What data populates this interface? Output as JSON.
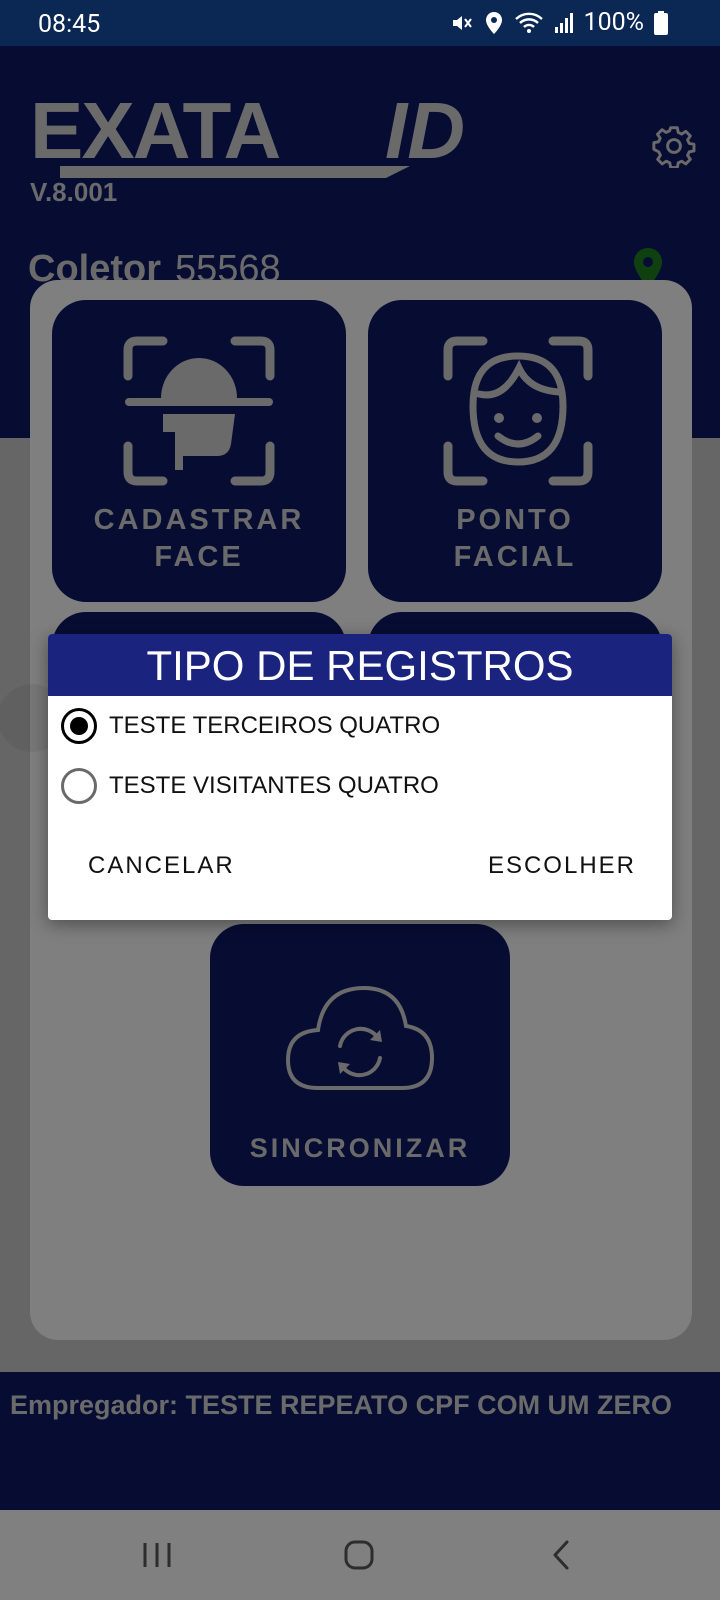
{
  "status_bar": {
    "time": "08:45",
    "battery_text": "100%",
    "icons": [
      "mute-icon",
      "location-icon",
      "wifi-icon",
      "signal-icon",
      "battery-icon"
    ]
  },
  "header": {
    "logo_text": "EXATAID",
    "version": "V.8.001",
    "settings_icon": "gear-icon",
    "coletor_label": "Coletor",
    "coletor_value": "55568",
    "location_icon": "map-pin-icon"
  },
  "tiles": {
    "cadastrar_face": {
      "line1": "CADASTRAR",
      "line2": "FACE",
      "icon": "face-scan-icon"
    },
    "ponto_facial": {
      "line1": "PONTO",
      "line2": "FACIAL",
      "icon": "face-recognition-icon"
    },
    "sincronizar": {
      "label": "SINCRONIZAR",
      "icon": "cloud-sync-icon"
    }
  },
  "footer": {
    "empregador": "Empregador: TESTE REPEATO CPF COM UM ZERO"
  },
  "dialog": {
    "title": "TIPO DE REGISTROS",
    "options": [
      {
        "label": "TESTE TERCEIROS QUATRO",
        "selected": true
      },
      {
        "label": "TESTE VISITANTES QUATRO",
        "selected": false
      }
    ],
    "cancel_label": "CANCELAR",
    "confirm_label": "ESCOLHER"
  },
  "nav_bar": {
    "icons": [
      "recent-apps-icon",
      "home-icon",
      "back-icon"
    ]
  },
  "colors": {
    "header_bg": "#0e1760",
    "dialog_title_bg": "#1a237e",
    "pin_green": "#1e7a1e"
  }
}
